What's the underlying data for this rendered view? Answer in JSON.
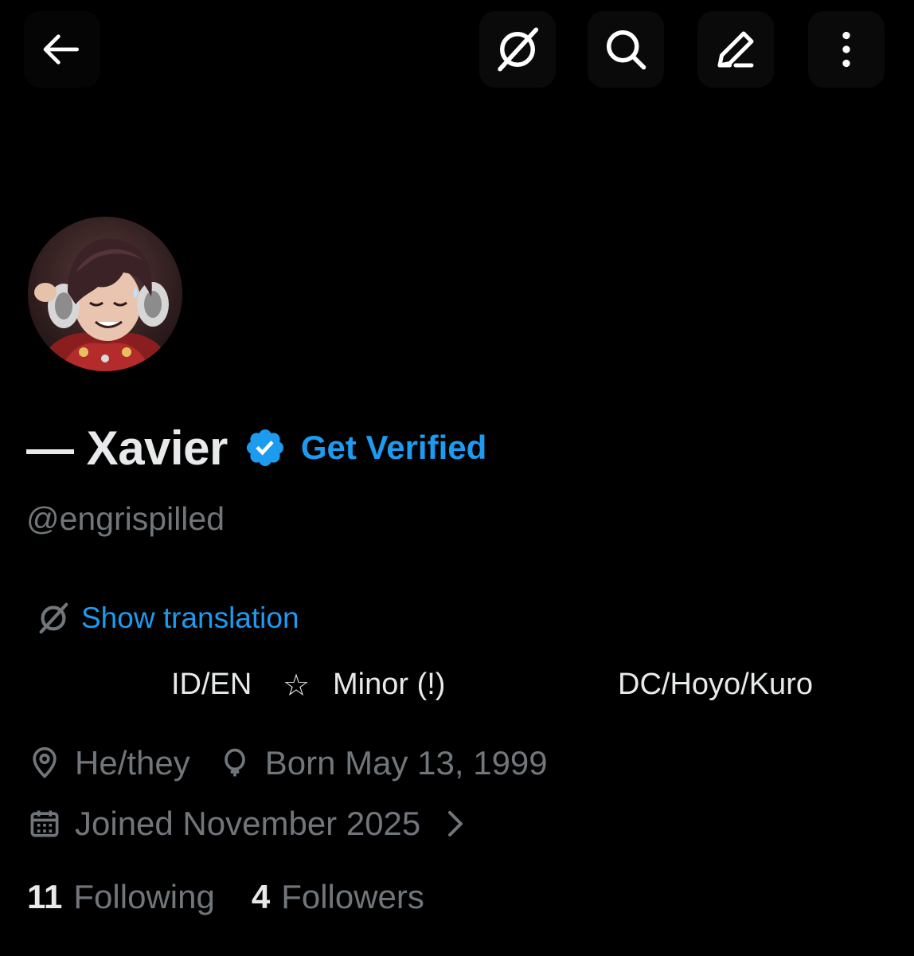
{
  "header": {
    "back_icon": "arrow-left-icon",
    "translate_icon": "translate-icon",
    "search_icon": "search-icon",
    "edit_icon": "edit-pencil-icon",
    "more_icon": "more-vertical-icon"
  },
  "profile": {
    "display_name": "— Xavier",
    "verified_badge": "verified-badge-icon",
    "get_verified_label": "Get Verified",
    "handle": "@engrispilled",
    "show_translation_label": "Show translation",
    "bio": {
      "part1": "ID/EN",
      "star": "☆",
      "part2": "Minor (!)",
      "part3": "DC/Hoyo/Kuro"
    },
    "pronouns": "He/they",
    "birthday": "Born May 13, 1999",
    "joined": "Joined November 2025",
    "following_count": "11",
    "following_label": "Following",
    "followers_count": "4",
    "followers_label": "Followers"
  },
  "colors": {
    "background": "#000000",
    "primary_text": "#e7e9ea",
    "secondary_text": "#71767b",
    "accent": "#1d9bf0"
  }
}
